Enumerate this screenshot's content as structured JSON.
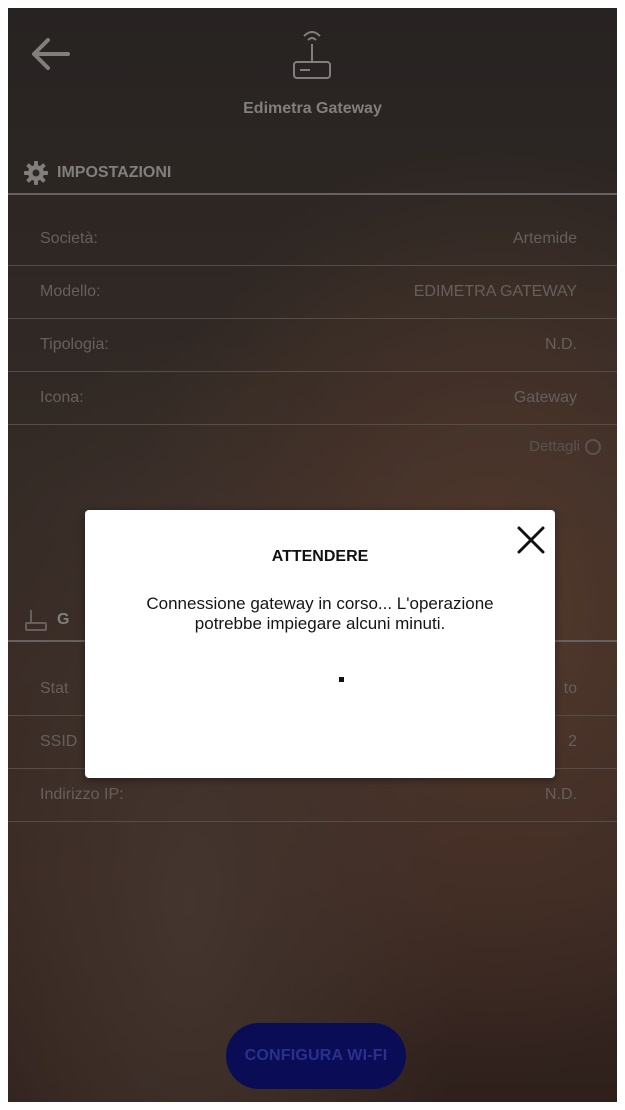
{
  "header": {
    "back_icon": "back-arrow-icon",
    "device_icon": "gateway-router-icon",
    "device_title": "Edimetra Gateway"
  },
  "settings": {
    "header_icon": "gear-icon",
    "header_label": "IMPOSTAZIONI",
    "rows": [
      {
        "label": "Società:",
        "value": "Artemide"
      },
      {
        "label": "Modello:",
        "value": "EDIMETRA GATEWAY"
      },
      {
        "label": "Tipologia:",
        "value": "N.D."
      },
      {
        "label": "Icona:",
        "value": "Gateway"
      }
    ],
    "details_label": "Dettagli"
  },
  "gateway_section": {
    "header_icon": "gateway-router-icon",
    "header_label": "G",
    "rows": [
      {
        "label": "Stat",
        "value": "to"
      },
      {
        "label": "SSID",
        "value": "2"
      },
      {
        "label": "Indirizzo IP:",
        "value": "N.D."
      }
    ]
  },
  "configure_button": {
    "label": "CONFIGURA WI-FI"
  },
  "modal": {
    "title": "ATTENDERE",
    "message": "Connessione gateway in corso... L'operazione potrebbe impiegare alcuni minuti.",
    "close_icon": "close-icon"
  },
  "colors": {
    "button_bg": "#0b0f5e",
    "button_text": "#2e3598",
    "modal_bg": "#ffffff"
  }
}
